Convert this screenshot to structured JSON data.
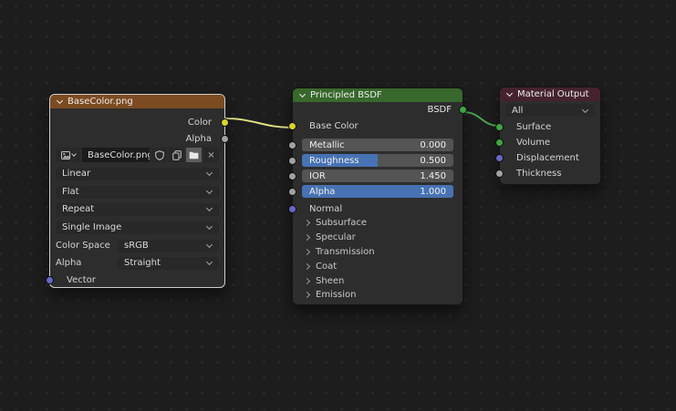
{
  "editor": {
    "background": "#1d1d1d",
    "grid_dot": "#2a2a2a"
  },
  "colors": {
    "header_texture": "#7d4b21",
    "header_shader": "#38682c",
    "header_output": "#45232e",
    "socket_color": "#d9d32b",
    "socket_value": "#a1a1a1",
    "socket_vector": "#6767c7",
    "socket_shader": "#3fa53f",
    "slider_fill": "#4772b3",
    "wire_color": "#e0e088",
    "wire_shader": "#4ca64c"
  },
  "icons": {
    "close": "×"
  },
  "nodes": {
    "image_texture": {
      "title": "BaseColor.png",
      "outputs": [
        {
          "label": "Color",
          "color": "#d9d32b"
        },
        {
          "label": "Alpha",
          "color": "#a1a1a1"
        }
      ],
      "image_name": "BaseColor.png",
      "settings": [
        {
          "value": "Linear"
        },
        {
          "value": "Flat"
        },
        {
          "value": "Repeat"
        },
        {
          "value": "Single Image"
        }
      ],
      "color_space": {
        "label": "Color Space",
        "value": "sRGB"
      },
      "alpha_mode": {
        "label": "Alpha",
        "value": "Straight"
      },
      "inputs": [
        {
          "label": "Vector",
          "color": "#6767c7"
        }
      ]
    },
    "principled": {
      "title": "Principled BSDF",
      "output": {
        "label": "BSDF",
        "color": "#3fa53f"
      },
      "base_color": {
        "label": "Base Color",
        "color": "#d9d32b"
      },
      "sliders": [
        {
          "label": "Metallic",
          "value": "0.000",
          "fill": 0
        },
        {
          "label": "Roughness",
          "value": "0.500",
          "fill": 0.5
        },
        {
          "label": "IOR",
          "value": "1.450",
          "fill": 0
        },
        {
          "label": "Alpha",
          "value": "1.000",
          "fill": 1
        }
      ],
      "normal": {
        "label": "Normal",
        "color": "#6767c7"
      },
      "sections": [
        "Subsurface",
        "Specular",
        "Transmission",
        "Coat",
        "Sheen",
        "Emission"
      ]
    },
    "material_output": {
      "title": "Material Output",
      "target": "All",
      "inputs": [
        {
          "label": "Surface",
          "color": "#3fa53f"
        },
        {
          "label": "Volume",
          "color": "#3fa53f"
        },
        {
          "label": "Displacement",
          "color": "#6767c7"
        },
        {
          "label": "Thickness",
          "color": "#a1a1a1"
        }
      ]
    }
  }
}
